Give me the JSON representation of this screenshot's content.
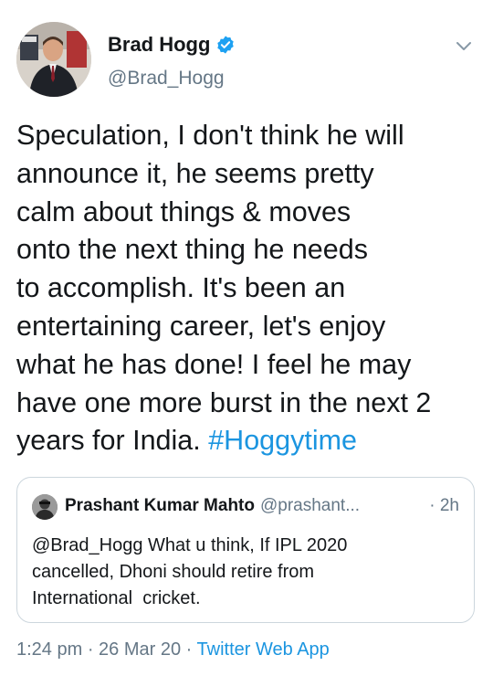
{
  "author": {
    "display_name": "Brad Hogg",
    "handle": "@Brad_Hogg",
    "verified": true
  },
  "tweet": {
    "lines": [
      "Speculation, I don't think he will",
      "announce it, he seems pretty",
      "calm about things & moves",
      "onto the next thing he needs",
      "to accomplish. It's been an",
      "entertaining career, let's enjoy",
      "what he has done! I feel he may",
      "have one more burst in the next 2"
    ],
    "last_line_text": "years for India. ",
    "hashtag": "#Hoggytime"
  },
  "quoted_tweet": {
    "display_name": "Prashant Kumar Mahto",
    "handle": "@prashant...",
    "time": "· 2h",
    "lines": [
      "@Brad_Hogg What u think, If IPL 2020",
      "cancelled, Dhoni should retire from",
      "International  cricket."
    ]
  },
  "footer": {
    "time": "1:24 pm",
    "separator1": " · ",
    "date": "26 Mar 20",
    "separator2": " · ",
    "source": "Twitter Web App"
  },
  "colors": {
    "link": "#1b95e0",
    "secondary_text": "#657786",
    "verified_badge": "#1da1f2",
    "border": "#ccd6dd"
  },
  "icons": {
    "verified": "verified-badge-icon",
    "menu": "chevron-down-icon"
  }
}
